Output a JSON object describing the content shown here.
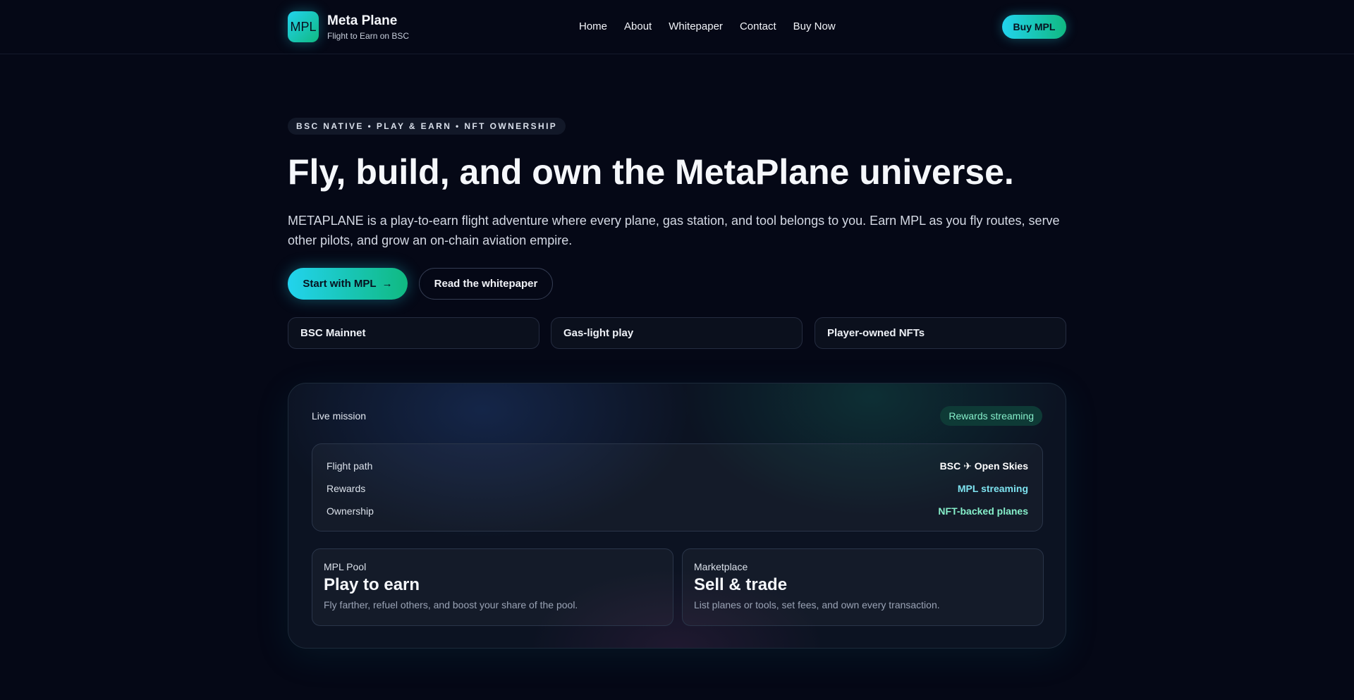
{
  "header": {
    "logo_text": "MPL",
    "brand_name": "Meta Plane",
    "brand_tagline": "Flight to Earn on BSC",
    "nav": [
      "Home",
      "About",
      "Whitepaper",
      "Contact",
      "Buy Now"
    ],
    "buy_button": "Buy MPL"
  },
  "hero": {
    "eyebrow": "BSC NATIVE • PLAY & EARN • NFT OWNERSHIP",
    "title": "Fly, build, and own the MetaPlane universe.",
    "description": "METAPLANE is a play-to-earn flight adventure where every plane, gas station, and tool belongs to you. Earn MPL as you fly routes, serve other pilots, and grow an on-chain aviation empire.",
    "primary_cta": "Start with MPL",
    "primary_cta_icon": "→",
    "secondary_cta": "Read the whitepaper",
    "features": [
      "BSC Mainnet",
      "Gas-light play",
      "Player-owned NFTs"
    ]
  },
  "mission": {
    "label": "Live mission",
    "badge": "Rewards streaming",
    "rows": [
      {
        "label": "Flight path",
        "value": "BSC ✈ Open Skies",
        "color": "#ffffff"
      },
      {
        "label": "Rewards",
        "value": "MPL streaming",
        "color": "#7ee3f0"
      },
      {
        "label": "Ownership",
        "value": "NFT-backed planes",
        "color": "#86efca"
      }
    ],
    "cards": [
      {
        "eyebrow": "MPL Pool",
        "title": "Play to earn",
        "desc": "Fly farther, refuel others, and boost your share of the pool."
      },
      {
        "eyebrow": "Marketplace",
        "title": "Sell & trade",
        "desc": "List planes or tools, set fees, and own every transaction."
      }
    ]
  },
  "colors": {
    "background": "#050816",
    "accent_start": "#22d3ee",
    "accent_end": "#10b981"
  }
}
